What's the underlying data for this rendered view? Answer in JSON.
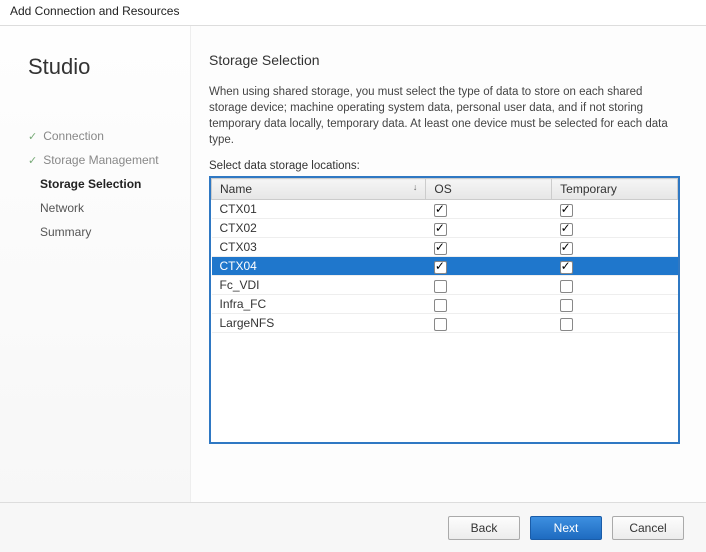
{
  "window": {
    "title": "Add Connection and Resources"
  },
  "sidebar": {
    "logo": "Studio",
    "steps": [
      {
        "label": "Connection",
        "state": "done"
      },
      {
        "label": "Storage Management",
        "state": "done"
      },
      {
        "label": "Storage Selection",
        "state": "current"
      },
      {
        "label": "Network",
        "state": "pending"
      },
      {
        "label": "Summary",
        "state": "pending"
      }
    ]
  },
  "main": {
    "heading": "Storage Selection",
    "description": "When using shared storage, you must select the type of data to store on each shared storage device; machine operating system data, personal user data, and if not storing temporary data locally, temporary data. At least one device must be selected for each data type.",
    "list_label": "Select data storage locations:",
    "columns": {
      "name": "Name",
      "os": "OS",
      "temp": "Temporary"
    },
    "rows": [
      {
        "name": "CTX01",
        "os": true,
        "temp": true,
        "selected": false
      },
      {
        "name": "CTX02",
        "os": true,
        "temp": true,
        "selected": false
      },
      {
        "name": "CTX03",
        "os": true,
        "temp": true,
        "selected": false
      },
      {
        "name": "CTX04",
        "os": true,
        "temp": true,
        "selected": true
      },
      {
        "name": "Fc_VDI",
        "os": false,
        "temp": false,
        "selected": false
      },
      {
        "name": "Infra_FC",
        "os": false,
        "temp": false,
        "selected": false
      },
      {
        "name": "LargeNFS",
        "os": false,
        "temp": false,
        "selected": false
      }
    ]
  },
  "footer": {
    "back": "Back",
    "next": "Next",
    "cancel": "Cancel"
  }
}
